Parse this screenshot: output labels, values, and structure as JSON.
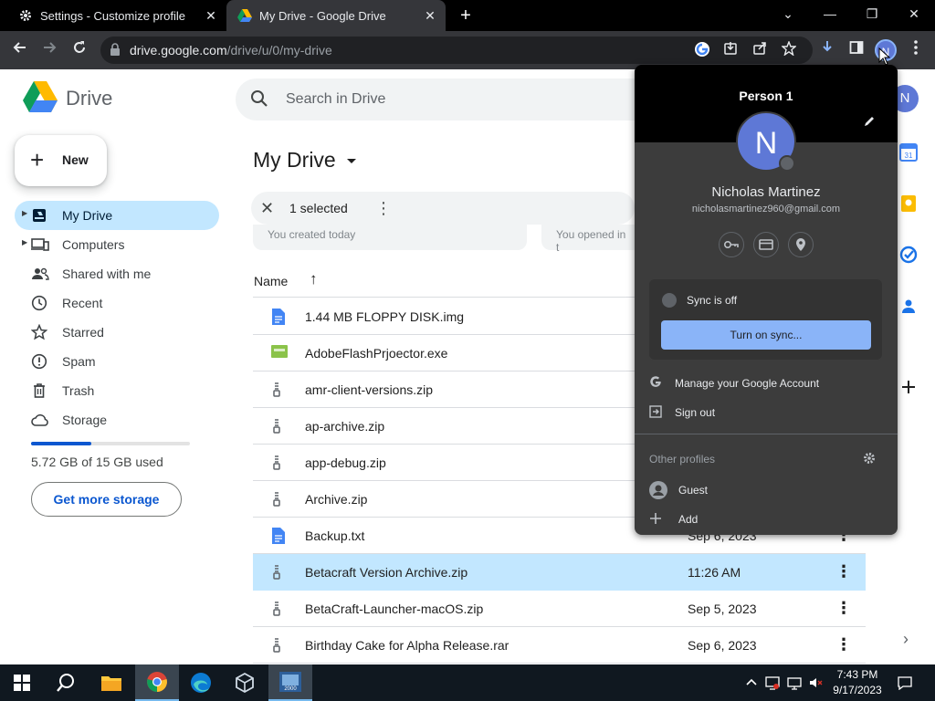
{
  "browser": {
    "tabs": [
      {
        "title": "Settings - Customize profile",
        "close": "✕"
      },
      {
        "title": "My Drive - Google Drive",
        "close": "✕"
      }
    ],
    "new_tab": "+",
    "window_controls": {
      "dropdown": "⌄",
      "minimize": "—",
      "maximize": "❐",
      "close": "✕"
    },
    "url_host": "drive.google.com",
    "url_path": "/drive/u/0/my-drive",
    "profile_initial": "N"
  },
  "drive": {
    "app_name": "Drive",
    "search_placeholder": "Search in Drive",
    "header_avatar": "N",
    "new_button": "New",
    "nav": [
      {
        "label": "My Drive",
        "icon": "my-drive-icon"
      },
      {
        "label": "Computers",
        "icon": "computers-icon"
      },
      {
        "label": "Shared with me",
        "icon": "shared-icon"
      },
      {
        "label": "Recent",
        "icon": "recent-icon"
      },
      {
        "label": "Starred",
        "icon": "star-icon"
      },
      {
        "label": "Spam",
        "icon": "spam-icon"
      },
      {
        "label": "Trash",
        "icon": "trash-icon"
      },
      {
        "label": "Storage",
        "icon": "cloud-icon"
      }
    ],
    "storage_used_fraction": 0.38,
    "storage_text": "5.72 GB of 15 GB used",
    "get_more_storage": "Get more storage",
    "folder_title": "My Drive",
    "selection": {
      "close": "✕",
      "count": "1 selected",
      "more": "⋮"
    },
    "suggested": [
      "You created today",
      "You opened in t"
    ],
    "columns": {
      "name": "Name",
      "sort_arrow": "↑"
    },
    "files": [
      {
        "name": "1.44 MB FLOPPY DISK.img",
        "date": "",
        "type": "doc"
      },
      {
        "name": "AdobeFlashPrjoector.exe",
        "date": "",
        "type": "exe"
      },
      {
        "name": "amr-client-versions.zip",
        "date": "",
        "type": "zip"
      },
      {
        "name": "ap-archive.zip",
        "date": "",
        "type": "zip"
      },
      {
        "name": "app-debug.zip",
        "date": "",
        "type": "zip"
      },
      {
        "name": "Archive.zip",
        "date": "",
        "type": "zip"
      },
      {
        "name": "Backup.txt",
        "date": "Sep 6, 2023",
        "type": "doc"
      },
      {
        "name": "Betacraft Version Archive.zip",
        "date": "11:26 AM",
        "type": "zip"
      },
      {
        "name": "BetaCraft-Launcher-macOS.zip",
        "date": "Sep 5, 2023",
        "type": "zip"
      },
      {
        "name": "Birthday Cake for Alpha Release.rar",
        "date": "Sep 6, 2023",
        "type": "zip"
      }
    ],
    "row_more": "⋮"
  },
  "profile_popup": {
    "person_label": "Person 1",
    "avatar_initial": "N",
    "full_name": "Nicholas Martinez",
    "email": "nicholasmartinez960@gmail.com",
    "sync_status": "Sync is off",
    "sync_button": "Turn on sync...",
    "manage_account": "Manage your Google Account",
    "sign_out": "Sign out",
    "other_profiles": "Other profiles",
    "guest": "Guest",
    "add": "Add"
  },
  "taskbar": {
    "time": "7:43 PM",
    "date": "9/17/2023"
  },
  "colors": {
    "selected_row": "#c2e7ff",
    "accent_blue": "#0b57d0",
    "sync_button": "#8ab4f8",
    "avatar": "#5e78d6"
  }
}
